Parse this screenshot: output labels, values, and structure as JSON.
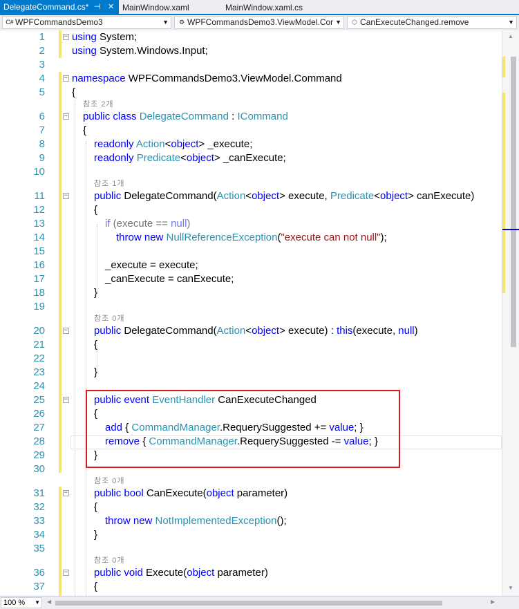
{
  "tabs": {
    "active": "DelegateCommand.cs*",
    "pin": "⊣",
    "close": "✕",
    "second": "MainWindow.xaml",
    "third": "MainWindow.xaml.cs"
  },
  "nav": {
    "project": "WPFCommandsDemo3",
    "type": "WPFCommandsDemo3.ViewModel.Cor",
    "member": "CanExecuteChanged.remove",
    "project_icon": "C#",
    "type_icon": "⚙",
    "member_icon": "⬡"
  },
  "refs": {
    "r2": "참조 2개",
    "r1": "참조 1개",
    "r0": "참조 0개"
  },
  "line_numbers": [
    "1",
    "2",
    "3",
    "4",
    "5",
    "6",
    "7",
    "8",
    "9",
    "10",
    "11",
    "12",
    "13",
    "14",
    "15",
    "16",
    "17",
    "18",
    "19",
    "20",
    "21",
    "22",
    "23",
    "24",
    "25",
    "26",
    "27",
    "28",
    "29",
    "30",
    "31",
    "32",
    "33",
    "34",
    "35",
    "36",
    "37"
  ],
  "code": {
    "l1": {
      "a": "using",
      "b": " System;"
    },
    "l2": {
      "a": "using",
      "b": " System.Windows.Input;"
    },
    "l4": {
      "a": "namespace",
      "b": " WPFCommandsDemo3.ViewModel.Command"
    },
    "l5": "{",
    "l6": {
      "a": "public class ",
      "b": "DelegateCommand",
      "c": " : ",
      "d": "ICommand"
    },
    "l7": "{",
    "l8": {
      "a": "readonly ",
      "b": "Action",
      "c": "<",
      "d": "object",
      "e": "> _execute;"
    },
    "l9": {
      "a": "readonly ",
      "b": "Predicate",
      "c": "<",
      "d": "object",
      "e": "> _canExecute;"
    },
    "l11": {
      "a": "public ",
      "b": "DelegateCommand(",
      "c": "Action",
      "d": "<",
      "e": "object",
      "f": "> execute, ",
      "g": "Predicate",
      "h": "<",
      "i": "object",
      "j": "> canExecute)"
    },
    "l12": "{",
    "l13": {
      "a": "if",
      "b": " (execute == ",
      "c": "null",
      "d": ")"
    },
    "l14": {
      "a": "throw new ",
      "b": "NullReferenceException",
      "c": "(",
      "d": "\"execute can not null\"",
      "e": ");"
    },
    "l16": "_execute = execute;",
    "l17": "_canExecute = canExecute;",
    "l18": "}",
    "l20": {
      "a": "public ",
      "b": "DelegateCommand(",
      "c": "Action",
      "d": "<",
      "e": "object",
      "f": "> execute) : ",
      "g": "this",
      "h": "(execute, ",
      "i": "null",
      "j": ")"
    },
    "l21": "{",
    "l23": "}",
    "l25": {
      "a": "public event ",
      "b": "EventHandler",
      "c": " CanExecuteChanged"
    },
    "l26": "{",
    "l27": {
      "a": "add",
      "b": " { ",
      "c": "CommandManager",
      "d": ".RequerySuggested += ",
      "e": "value",
      "f": "; }"
    },
    "l28": {
      "a": "remove",
      "b": " { ",
      "c": "CommandManager",
      "d": ".RequerySuggested -= ",
      "e": "value",
      "f": "; }"
    },
    "l29": "}",
    "l31": {
      "a": "public bool ",
      "b": "CanExecute(",
      "c": "object",
      "d": " parameter)"
    },
    "l32": "{",
    "l33": {
      "a": "throw new ",
      "b": "NotImplementedException",
      "c": "();"
    },
    "l34": "}",
    "l36": {
      "a": "public void ",
      "b": "Execute(",
      "c": "object",
      "d": " parameter)"
    },
    "l37": "{"
  },
  "zoom": "100 %",
  "colors": {
    "accent": "#007acc",
    "keyword": "#0000ff",
    "type": "#2b91af",
    "string": "#a31515",
    "highlight_box": "#d7191a",
    "change_marker": "#f2e66f"
  }
}
